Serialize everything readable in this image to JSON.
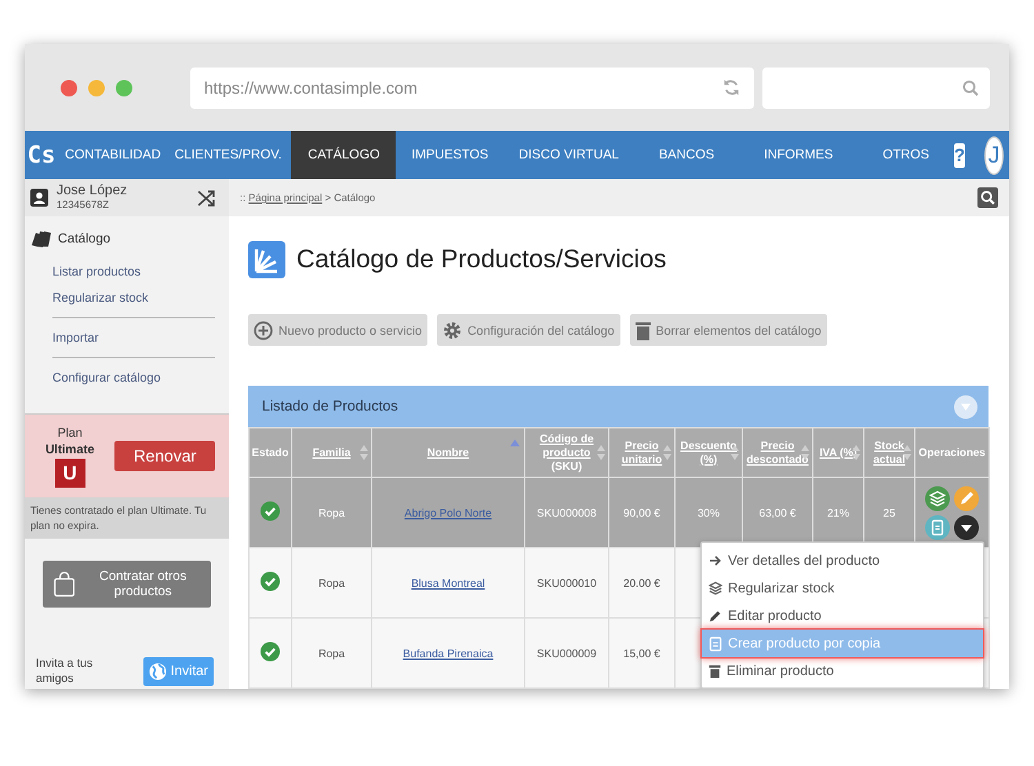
{
  "browser": {
    "url": "https://www.contasimple.com"
  },
  "nav": {
    "logo": "Cs",
    "items": [
      {
        "label": "CONTABILIDAD",
        "selected": false
      },
      {
        "label": "CLIENTES/PROV.",
        "selected": false
      },
      {
        "label": "CATÁLOGO",
        "selected": true
      },
      {
        "label": "IMPUESTOS",
        "selected": false
      },
      {
        "label": "DISCO VIRTUAL",
        "selected": false
      },
      {
        "label": "BANCOS",
        "selected": false
      },
      {
        "label": "INFORMES",
        "selected": false
      },
      {
        "label": "OTROS",
        "selected": false
      }
    ],
    "help": "?",
    "avatar": "J"
  },
  "user": {
    "name": "Jose López",
    "id": "12345678Z"
  },
  "sidebar": {
    "section": "Catálogo",
    "groups": [
      [
        "Listar productos",
        "Regularizar stock"
      ],
      [
        "Importar"
      ],
      [
        "Configurar catálogo"
      ]
    ]
  },
  "plan": {
    "label": "Plan",
    "name": "Ultimate",
    "badge": "U",
    "renew": "Renovar",
    "note": "Tienes contratado el plan Ultimate. Tu plan no expira."
  },
  "contract_button": "Contratar otros productos",
  "invite": {
    "text": "Invita a tus amigos",
    "button": "Invitar"
  },
  "breadcrumb": {
    "prefix": "::",
    "link": "Página principal",
    "separator": ">",
    "current": "Catálogo"
  },
  "title": "Catálogo de Productos/Servicios",
  "toolbar": [
    {
      "kind": "plus",
      "label": "Nuevo producto o servicio"
    },
    {
      "kind": "gear",
      "label": "Configuración del catálogo"
    },
    {
      "kind": "trash",
      "label": "Borrar elementos del catálogo"
    }
  ],
  "table": {
    "title": "Listado de Productos",
    "columns": [
      {
        "label": "Estado",
        "sortable": false,
        "sorted_ascending": false
      },
      {
        "label": "Familia",
        "sortable": true,
        "sorted_ascending": false
      },
      {
        "label": "Nombre",
        "sortable": true,
        "sorted_ascending": true
      },
      {
        "label": "Código de producto",
        "sub": "(SKU)",
        "sortable": true,
        "sorted_ascending": false
      },
      {
        "label": "Precio unitario",
        "sortable": true,
        "sorted_ascending": false
      },
      {
        "label": "Descuento (%)",
        "sortable": true,
        "sorted_ascending": false
      },
      {
        "label": "Precio descontado",
        "sortable": true,
        "sorted_ascending": false
      },
      {
        "label": "IVA (%)",
        "sortable": true,
        "sorted_ascending": false
      },
      {
        "label": "Stock actual",
        "sortable": true,
        "sorted_ascending": false
      },
      {
        "label": "Operaciones",
        "sortable": false,
        "sorted_ascending": false
      }
    ],
    "rows": [
      {
        "selected": true,
        "active": true,
        "cells": [
          "",
          "Ropa",
          "Abrigo Polo Norte",
          "SKU000008",
          "90,00 €",
          "30%",
          "63,00 €",
          "21%",
          "25",
          ""
        ]
      },
      {
        "selected": false,
        "active": true,
        "cells": [
          "",
          "Ropa",
          "Blusa Montreal",
          "SKU000010",
          "20.00 €",
          "",
          "",
          "",
          "",
          ""
        ]
      },
      {
        "selected": false,
        "active": true,
        "cells": [
          "",
          "Ropa",
          "Bufanda Pirenaica",
          "SKU000009",
          "15,00 €",
          "",
          "",
          "",
          "",
          ""
        ]
      }
    ],
    "menu": [
      {
        "kind": "arrow",
        "label": "Ver detalles del producto",
        "selected": false
      },
      {
        "kind": "stack",
        "label": "Regularizar stock",
        "selected": false
      },
      {
        "kind": "pencil",
        "label": "Editar producto",
        "selected": false
      },
      {
        "kind": "copy",
        "label": "Crear producto por copia",
        "selected": true
      },
      {
        "kind": "trash",
        "label": "Eliminar producto",
        "selected": false
      }
    ]
  }
}
